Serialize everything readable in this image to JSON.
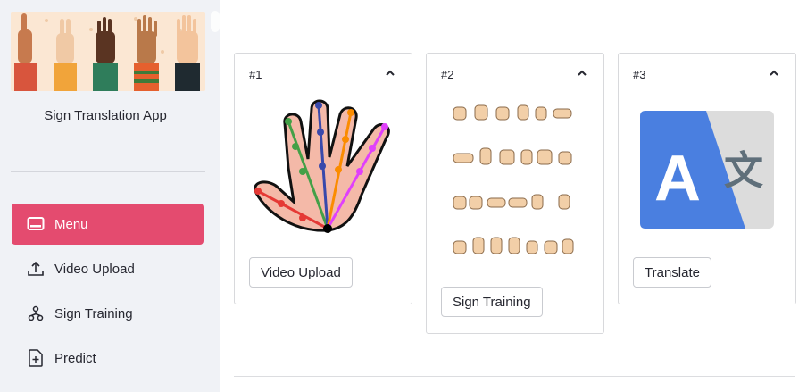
{
  "sidebar": {
    "app_title": "Sign Translation App",
    "items": [
      {
        "label": "Menu",
        "icon": "window-icon",
        "active": true
      },
      {
        "label": "Video Upload",
        "icon": "upload-icon",
        "active": false
      },
      {
        "label": "Sign Training",
        "icon": "diagram-icon",
        "active": false
      },
      {
        "label": "Predict",
        "icon": "file-plus-icon",
        "active": false
      }
    ]
  },
  "cards": [
    {
      "number": "#1",
      "button": "Video Upload",
      "image": "hand-landmarks-icon"
    },
    {
      "number": "#2",
      "button": "Sign Training",
      "image": "sign-alphabet-icon"
    },
    {
      "number": "#3",
      "button": "Translate",
      "image": "translate-icon"
    }
  ],
  "colors": {
    "accent": "#e44b6f",
    "sidebar_bg": "#f0f2f6",
    "translate_blue": "#4a7fe0",
    "translate_gray": "#dcdcdc"
  }
}
